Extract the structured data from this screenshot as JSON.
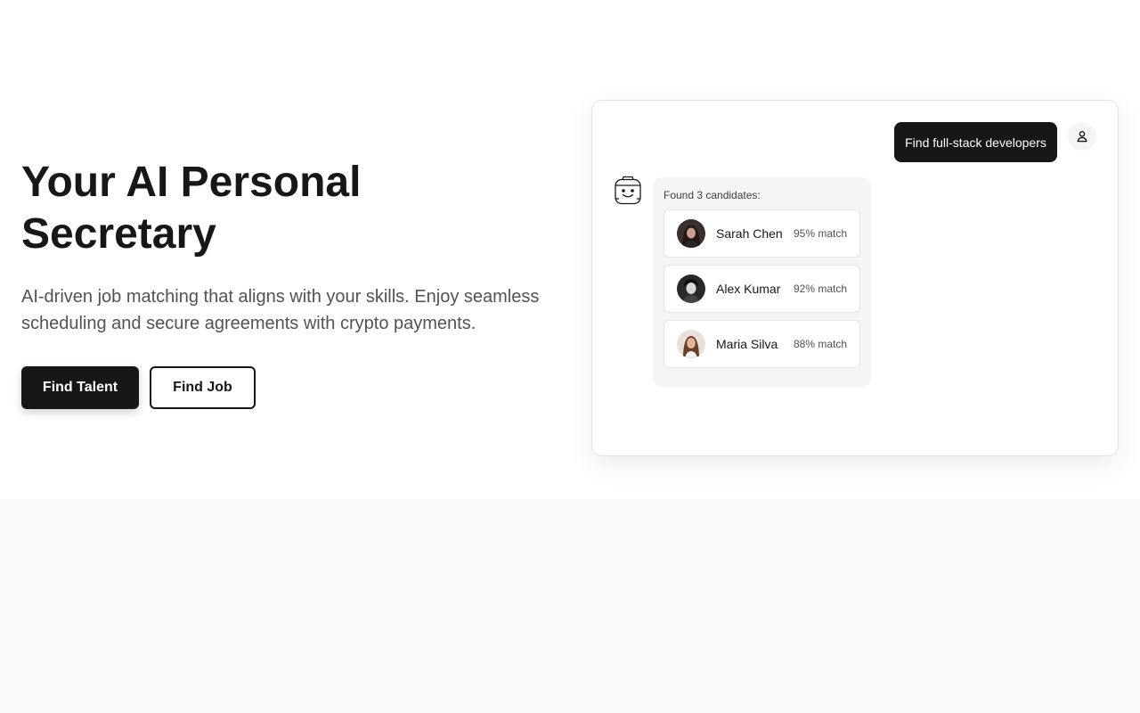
{
  "hero": {
    "title": "Your AI Personal Secretary",
    "subtitle": "AI-driven job matching that aligns with your skills. Enjoy seamless scheduling and secure agreements with crypto payments.",
    "primary_button": "Find Talent",
    "secondary_button": "Find Job"
  },
  "chat": {
    "user_message": "Find full-stack developers",
    "user_icon": "user-icon",
    "bot_icon": "robot-icon",
    "results_label": "Found 3 candidates:",
    "candidates": [
      {
        "name": "Sarah Chen",
        "match": "95% match"
      },
      {
        "name": "Alex Kumar",
        "match": "92% match"
      },
      {
        "name": "Maria Silva",
        "match": "88% match"
      }
    ]
  },
  "colors": {
    "primary": "#171717",
    "text_muted": "#525252",
    "panel_bg": "#f5f5f5",
    "section_bg": "#fafafa"
  }
}
